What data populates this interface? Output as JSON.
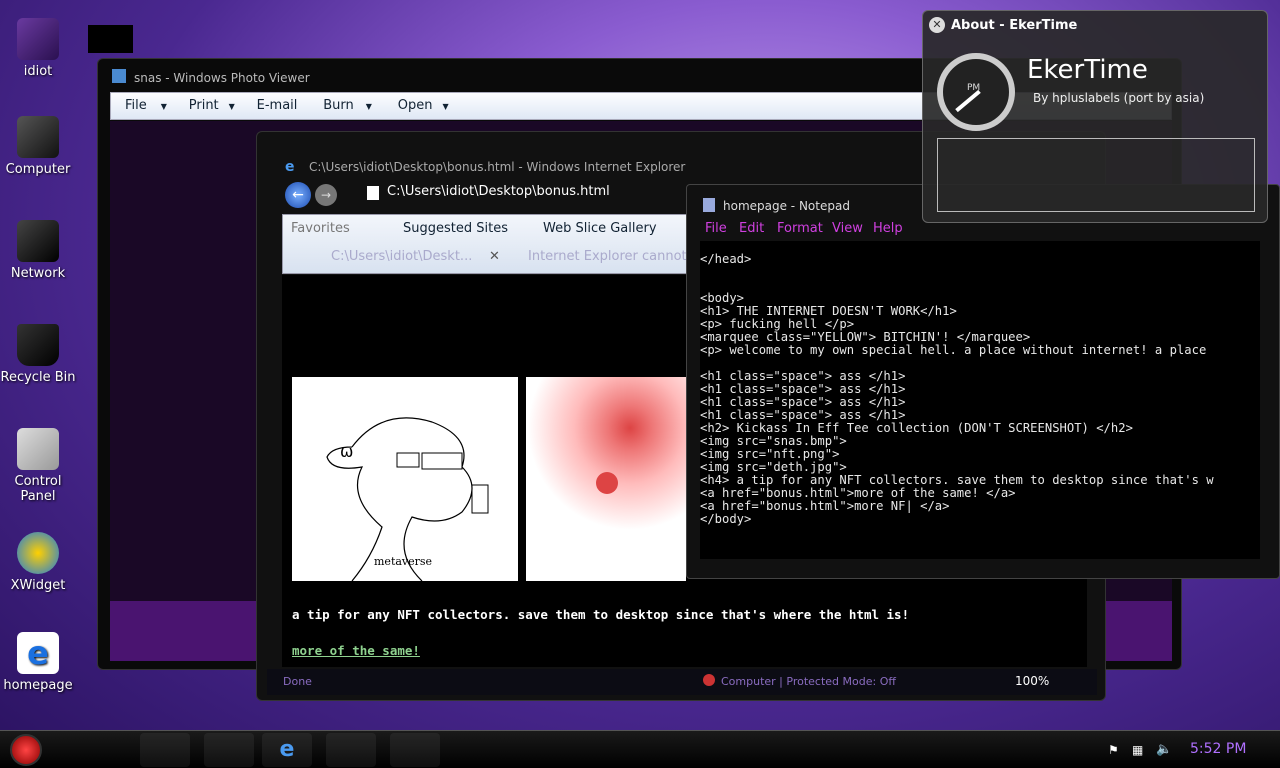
{
  "desktop_icons": [
    {
      "label": "idiot"
    },
    {
      "label": "Computer"
    },
    {
      "label": "Network"
    },
    {
      "label": "Recycle Bin"
    },
    {
      "label": "Control Panel"
    },
    {
      "label": "XWidget"
    },
    {
      "label": "homepage"
    }
  ],
  "photo_viewer": {
    "title": "snas - Windows Photo Viewer",
    "menu": [
      "File",
      "Print",
      "E-mail",
      "Burn",
      "Open"
    ]
  },
  "ie": {
    "title": "C:\\Users\\idiot\\Desktop\\bonus.html - Windows Internet Explorer",
    "address": "C:\\Users\\idiot\\Desktop\\bonus.html",
    "favorites": "Favorites",
    "suggested_sites": "Suggested Sites",
    "web_slice": "Web Slice Gallery",
    "tab1": "C:\\Users\\idiot\\Deskt...",
    "tab2": "Internet Explorer cannot...",
    "image_caption": "metaverse",
    "page_text": "a tip for any NFT collectors. save them to desktop since that's where the html is!",
    "link": "more of the same!",
    "status_done": "Done",
    "status_zone": "Computer | Protected Mode: Off",
    "zoom": "100%"
  },
  "notepad": {
    "title": "homepage - Notepad",
    "menu": [
      "File",
      "Edit",
      "Format",
      "View",
      "Help"
    ],
    "lines": [
      "</head>",
      "",
      "",
      "<body>",
      "<h1> THE INTERNET DOESN'T WORK</h1>",
      "<p> fucking hell </p>",
      "<marquee class=\"YELLOW\"> BITCHIN'! </marquee>",
      "<p> welcome to my own special hell. a place without internet! a place",
      "",
      "<h1 class=\"space\"> ass </h1>",
      "<h1 class=\"space\"> ass </h1>",
      "<h1 class=\"space\"> ass </h1>",
      "<h1 class=\"space\"> ass </h1>",
      "<h2> Kickass In Eff Tee collection (DON'T SCREENSHOT) </h2>",
      "<img src=\"snas.bmp\">",
      "<img src=\"nft.png\">",
      "<img src=\"deth.jpg\">",
      "<h4> a tip for any NFT collectors. save them to desktop since that's w",
      "<a href=\"bonus.html\">more of the same! </a>",
      "<a href=\"bonus.html\">more NF| </a>",
      "</body>"
    ]
  },
  "ekertime": {
    "window_title": "About - EkerTime",
    "app_name": "EkerTime",
    "byline": "By hpluslabels (port by asia)",
    "clock_label": "PM"
  },
  "taskbar": {
    "time": "5:52 PM"
  }
}
